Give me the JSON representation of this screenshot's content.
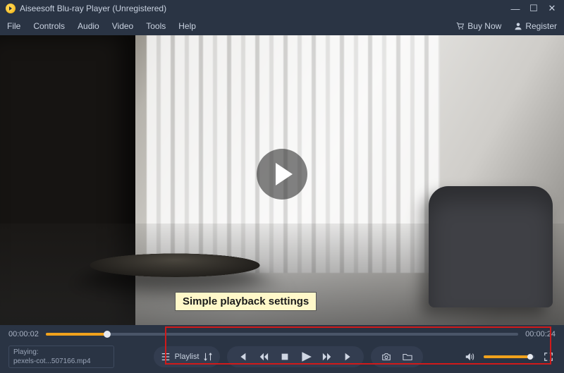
{
  "titlebar": {
    "title": "Aiseesoft Blu-ray Player (Unregistered)"
  },
  "menu": {
    "file": "File",
    "controls": "Controls",
    "audio": "Audio",
    "video": "Video",
    "tools": "Tools",
    "help": "Help",
    "buy_now": "Buy Now",
    "register": "Register"
  },
  "playback": {
    "current_time": "00:00:02",
    "duration": "00:00:24",
    "progress_percent": 13
  },
  "nowplaying": {
    "label": "Playing:",
    "filename": "pexels-cot...507166.mp4"
  },
  "controls": {
    "playlist_label": "Playlist"
  },
  "volume": {
    "percent": 92
  },
  "annotation": {
    "callout": "Simple playback settings"
  },
  "colors": {
    "accent": "#f1a21c",
    "bg": "#2a3444"
  }
}
